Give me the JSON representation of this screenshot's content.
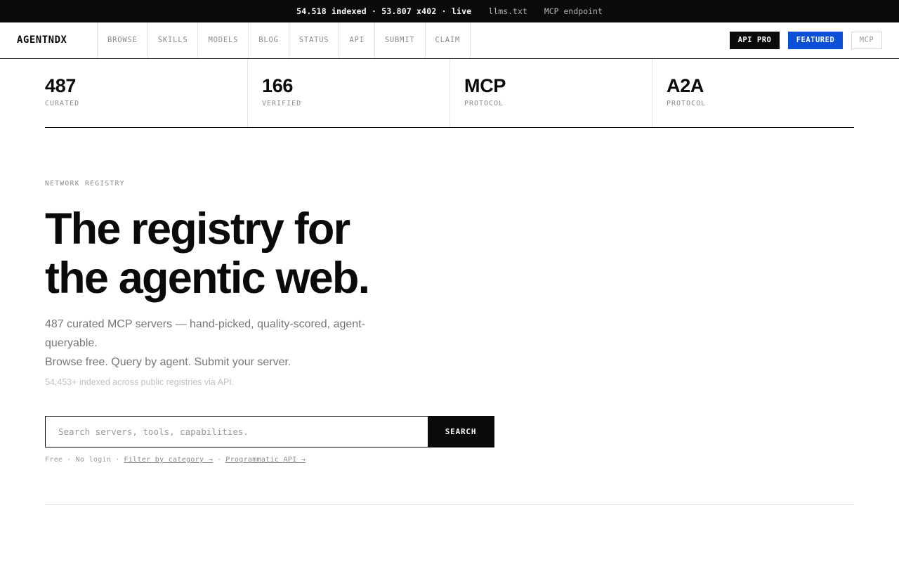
{
  "topbar": {
    "stats": "54.518 indexed · 53.807 x402 · live",
    "links": [
      "llms.txt",
      "MCP endpoint"
    ]
  },
  "header": {
    "logo": "AGENTNDX",
    "nav": [
      "BROWSE",
      "SKILLS",
      "MODELS",
      "BLOG",
      "STATUS",
      "API",
      "SUBMIT",
      "CLAIM"
    ],
    "buttons": {
      "api_pro": "API PRO",
      "featured": "FEATURED",
      "mcp": "MCP"
    }
  },
  "stats": [
    {
      "value": "487",
      "label": "CURATED"
    },
    {
      "value": "166",
      "label": "VERIFIED"
    },
    {
      "value": "MCP",
      "label": "PROTOCOL"
    },
    {
      "value": "A2A",
      "label": "PROTOCOL"
    }
  ],
  "hero": {
    "eyebrow": "NETWORK REGISTRY",
    "headline_line1": "The registry for",
    "headline_line2": "the agentic web.",
    "description": "487 curated MCP servers — hand-picked, quality-scored, agent-queryable.",
    "tagline": "Browse free. Query by agent. Submit your server.",
    "indexed_note": "54,453+ indexed across public registries via API."
  },
  "search": {
    "placeholder": "Search servers, tools, capabilities.",
    "button": "SEARCH",
    "meta_free": "Free",
    "meta_login": "No login",
    "link_category": "Filter by category →",
    "link_api": "Programmatic API →"
  },
  "colors": {
    "accent": "#0b4fd8",
    "dark": "#0a0a0a",
    "muted": "#8a8a8a"
  }
}
